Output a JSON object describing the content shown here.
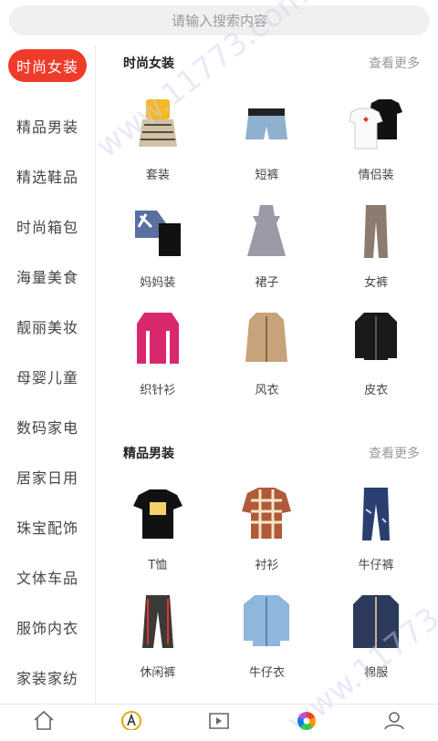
{
  "search": {
    "placeholder": "请输入搜索内容"
  },
  "sidebar": {
    "items": [
      {
        "label": "时尚女装"
      },
      {
        "label": "精品男装"
      },
      {
        "label": "精选鞋品"
      },
      {
        "label": "时尚箱包"
      },
      {
        "label": "海量美食"
      },
      {
        "label": "靓丽美妆"
      },
      {
        "label": "母婴儿童"
      },
      {
        "label": "数码家电"
      },
      {
        "label": "居家日用"
      },
      {
        "label": "珠宝配饰"
      },
      {
        "label": "文体车品"
      },
      {
        "label": "服饰内衣"
      },
      {
        "label": "家装家纺"
      }
    ]
  },
  "sections": [
    {
      "title": "时尚女装",
      "more": "查看更多",
      "items": [
        {
          "label": "套装",
          "icon": "outfit-set-icon"
        },
        {
          "label": "短裤",
          "icon": "shorts-icon"
        },
        {
          "label": "情侣装",
          "icon": "couple-tshirt-icon"
        },
        {
          "label": "妈妈装",
          "icon": "mom-outfit-icon"
        },
        {
          "label": "裙子",
          "icon": "dress-icon"
        },
        {
          "label": "女裤",
          "icon": "women-pants-icon"
        },
        {
          "label": "织针衫",
          "icon": "sweater-icon"
        },
        {
          "label": "风衣",
          "icon": "trench-coat-icon"
        },
        {
          "label": "皮衣",
          "icon": "leather-jacket-icon"
        }
      ]
    },
    {
      "title": "精品男装",
      "more": "查看更多",
      "items": [
        {
          "label": "T恤",
          "icon": "tshirt-icon"
        },
        {
          "label": "衬衫",
          "icon": "plaid-shirt-icon"
        },
        {
          "label": "牛仔裤",
          "icon": "jeans-icon"
        },
        {
          "label": "休闲裤",
          "icon": "casual-pants-icon"
        },
        {
          "label": "牛仔衣",
          "icon": "denim-jacket-icon"
        },
        {
          "label": "棉服",
          "icon": "padded-coat-icon"
        }
      ]
    }
  ],
  "watermark": {
    "text": "www.11773.com"
  },
  "tabbar": {
    "items": [
      {
        "icon": "home-icon"
      },
      {
        "icon": "a-badge-icon"
      },
      {
        "icon": "video-play-icon"
      },
      {
        "icon": "color-wheel-icon"
      },
      {
        "icon": "profile-icon"
      }
    ]
  }
}
